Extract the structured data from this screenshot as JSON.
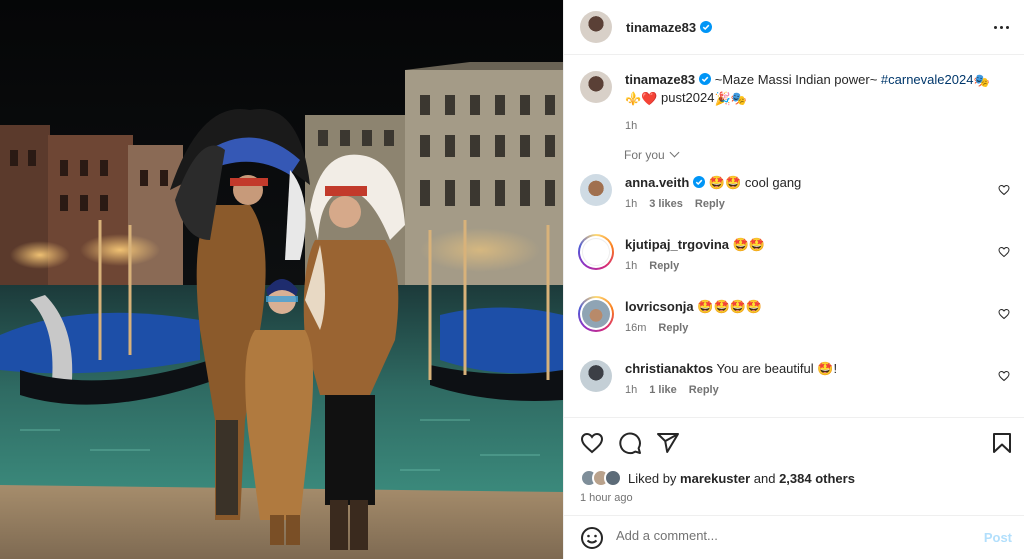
{
  "post": {
    "author": "tinamaze83",
    "more_icon": "more-horizontal-icon"
  },
  "caption": {
    "author": "tinamaze83",
    "text": " ~Maze Massi Indian power~ ",
    "hashtag": "#carnevale2024",
    "emoji_1": "🎭",
    "emoji_2": "⚜️",
    "emoji_3": "❤️",
    "text_2": " pust2024",
    "emoji_4": "🎉",
    "emoji_5": "🎭",
    "time": "1h"
  },
  "for_you": "For you",
  "comments": [
    {
      "user": "anna.veith",
      "verified": true,
      "text": "🤩🤩 cool gang",
      "time": "1h",
      "likes": "3 likes",
      "reply": "Reply"
    },
    {
      "user": "kjutipaj_trgovina",
      "verified": false,
      "text": "🤩🤩",
      "time": "1h",
      "likes": "",
      "reply": "Reply"
    },
    {
      "user": "lovricsonja",
      "verified": false,
      "text": "🤩🤩🤩🤩",
      "time": "16m",
      "likes": "",
      "reply": "Reply"
    },
    {
      "user": "christianaktos",
      "verified": false,
      "text": "You are beautiful 🤩!",
      "time": "1h",
      "likes": "1 like",
      "reply": "Reply"
    }
  ],
  "likes": {
    "prefix": "Liked by ",
    "user": "marekuster",
    "mid": " and ",
    "others": "2,384 others"
  },
  "posted_ago": "1 hour ago",
  "add_comment": {
    "placeholder": "Add a comment...",
    "post_label": "Post"
  },
  "colors": {
    "verified": "#0095f6",
    "link": "#00376b",
    "muted": "#737373",
    "post_disabled": "#b2dffc"
  }
}
